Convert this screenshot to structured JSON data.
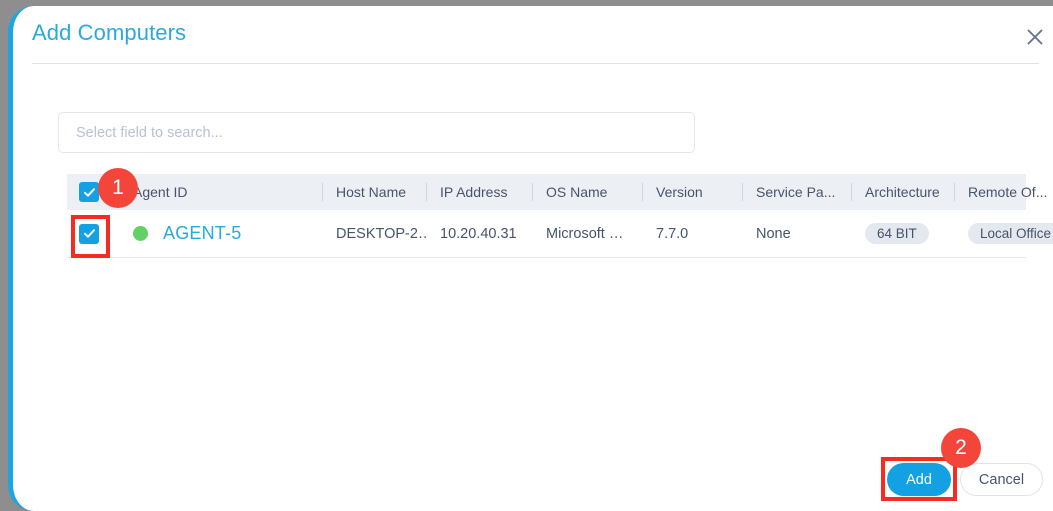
{
  "dialog": {
    "title": "Add Computers",
    "close_icon": "close-icon"
  },
  "search": {
    "placeholder": "Select field to search...",
    "value": ""
  },
  "table": {
    "headers": [
      {
        "key": "select",
        "label": ""
      },
      {
        "key": "agent_id",
        "label": "Agent ID"
      },
      {
        "key": "host_name",
        "label": "Host Name"
      },
      {
        "key": "ip_address",
        "label": "IP Address"
      },
      {
        "key": "os_name",
        "label": "OS Name"
      },
      {
        "key": "version",
        "label": "Version"
      },
      {
        "key": "service_pack",
        "label": "Service Pa..."
      },
      {
        "key": "architecture",
        "label": "Architecture"
      },
      {
        "key": "remote_office",
        "label": "Remote Of..."
      }
    ],
    "header_select_all_checked": true,
    "rows": [
      {
        "selected": true,
        "status": "online",
        "agent_id": "AGENT-5",
        "host_name": "DESKTOP-2…",
        "ip_address": "10.20.40.31",
        "os_name": "Microsoft …",
        "version": "7.7.0",
        "service_pack": "None",
        "architecture": "64 BIT",
        "remote_office": "Local Office"
      }
    ]
  },
  "footer": {
    "add_label": "Add",
    "cancel_label": "Cancel"
  },
  "annotations": {
    "step_one": "1",
    "step_two": "2"
  },
  "colors": {
    "accent": "#14a1e3",
    "title": "#2ca8e0",
    "highlight": "#f62b22",
    "badge": "#f4453a",
    "status_online": "#63d266",
    "header_bg": "#eceff4",
    "pill_bg": "#e4e8ef",
    "text": "#47546a"
  }
}
